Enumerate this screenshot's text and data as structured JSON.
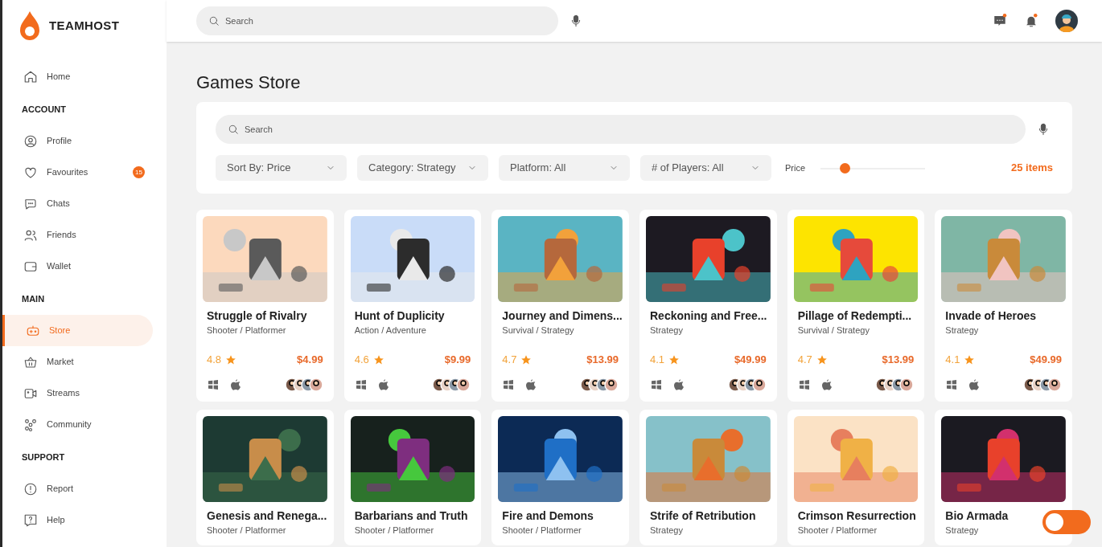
{
  "brand": "TEAMHOST",
  "sidebar": {
    "sections": [
      {
        "items": [
          {
            "label": "Home",
            "selected": false
          }
        ]
      },
      {
        "heading": "ACCOUNT",
        "items": [
          {
            "label": "Profile",
            "selected": false
          },
          {
            "label": "Favourites",
            "selected": false,
            "badge": "15"
          },
          {
            "label": "Chats",
            "selected": false
          },
          {
            "label": "Friends",
            "selected": false
          },
          {
            "label": "Wallet",
            "selected": false
          }
        ]
      },
      {
        "heading": "MAIN",
        "items": [
          {
            "label": "Store",
            "selected": true
          },
          {
            "label": "Market",
            "selected": false
          },
          {
            "label": "Streams",
            "selected": false
          },
          {
            "label": "Community",
            "selected": false
          }
        ]
      },
      {
        "heading": "SUPPORT",
        "items": [
          {
            "label": "Report",
            "selected": false
          },
          {
            "label": "Help",
            "selected": false
          }
        ]
      }
    ]
  },
  "theme_toggle": {
    "on": false
  },
  "topbar": {
    "search": {
      "placeholder": "Search"
    },
    "notifications": {
      "messages_unread": true,
      "bell_unread": true
    }
  },
  "page_title": "Games Store",
  "filters": {
    "search": {
      "placeholder": "Search"
    },
    "dropdowns": [
      "Sort By: Price",
      "Category: Strategy",
      "Platform: All",
      "# of Players: All"
    ],
    "price": {
      "label": "Price",
      "level": 0.23
    },
    "count": "25 items"
  },
  "games": [
    {
      "title": "Struggle of Rivalry",
      "genre": "Shooter / Platformer",
      "rating": "4.8",
      "price": "$4.99"
    },
    {
      "title": "Hunt of Duplicity",
      "genre": "Action / Adventure",
      "rating": "4.6",
      "price": "$9.99"
    },
    {
      "title": "Journey and Dimens...",
      "genre": "Survival / Strategy",
      "rating": "4.7",
      "price": "$13.99"
    },
    {
      "title": "Reckoning and Free...",
      "genre": "Strategy",
      "rating": "4.1",
      "price": "$49.99"
    },
    {
      "title": "Pillage of Redempti...",
      "genre": "Survival / Strategy",
      "rating": "4.7",
      "price": "$13.99"
    },
    {
      "title": "Invade of Heroes",
      "genre": "Strategy",
      "rating": "4.1",
      "price": "$49.99"
    },
    {
      "title": "Genesis and Renega...",
      "genre": "Shooter / Platformer"
    },
    {
      "title": "Barbarians and Truth",
      "genre": "Shooter / Platformer"
    },
    {
      "title": "Fire and Demons",
      "genre": "Shooter / Platformer"
    },
    {
      "title": "Strife of Retribution",
      "genre": "Strategy"
    },
    {
      "title": "Crimson Resurrection",
      "genre": "Shooter / Platformer"
    },
    {
      "title": "Bio Armada",
      "genre": "Strategy"
    }
  ]
}
